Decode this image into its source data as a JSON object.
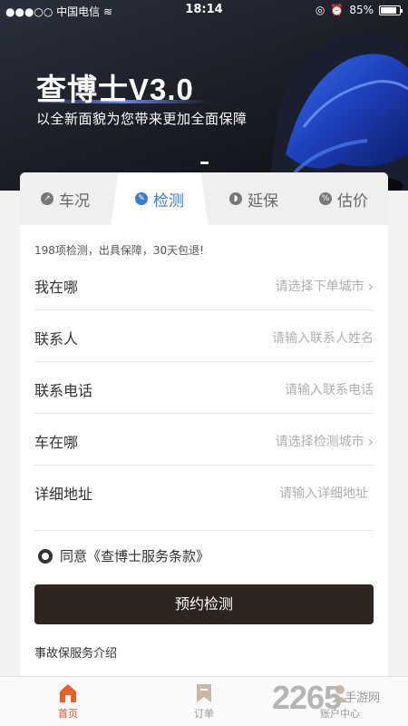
{
  "status_bar": {
    "carrier": "中国电信",
    "time": "18:14",
    "battery": "85%",
    "battery_level": 0.85
  },
  "banner": {
    "title": "查博士V3.0",
    "subtitle": "以全新面貌为您带来更加全面保障"
  },
  "tabs": [
    {
      "label": "车况",
      "icon": "chart-icon",
      "active": false
    },
    {
      "label": "检测",
      "icon": "wrench-icon",
      "active": true
    },
    {
      "label": "延保",
      "icon": "shield-icon",
      "active": false
    },
    {
      "label": "估价",
      "icon": "percent-icon",
      "active": false
    }
  ],
  "form": {
    "promo": "198项检测，出具保障，30天包退!",
    "fields": [
      {
        "label": "我在哪",
        "placeholder": "请选择下单城市",
        "chevron": true
      },
      {
        "label": "联系人",
        "placeholder": "请输入联系人姓名",
        "chevron": false
      },
      {
        "label": "联系电话",
        "placeholder": "请输入联系电话",
        "chevron": false
      },
      {
        "label": "车在哪",
        "placeholder": "请选择检测城市",
        "chevron": true
      },
      {
        "label": "详细地址",
        "placeholder": "请输入详细地址",
        "chevron": false
      }
    ],
    "agree_text": "同意《查博士服务条款》",
    "submit_label": "预约检测",
    "intro_link": "事故保服务介绍"
  },
  "bottom_nav": [
    {
      "label": "首页",
      "icon": "home-icon",
      "active": true
    },
    {
      "label": "订单",
      "icon": "bookmark-icon",
      "active": false
    },
    {
      "label": "账户中心",
      "icon": "user-icon",
      "active": false
    }
  ],
  "watermark": {
    "number": "2265",
    "site": "手游网"
  },
  "colors": {
    "accent_blue": "#3a7bd5",
    "button_dark": "#2e2521",
    "nav_active": "#e8612c"
  }
}
